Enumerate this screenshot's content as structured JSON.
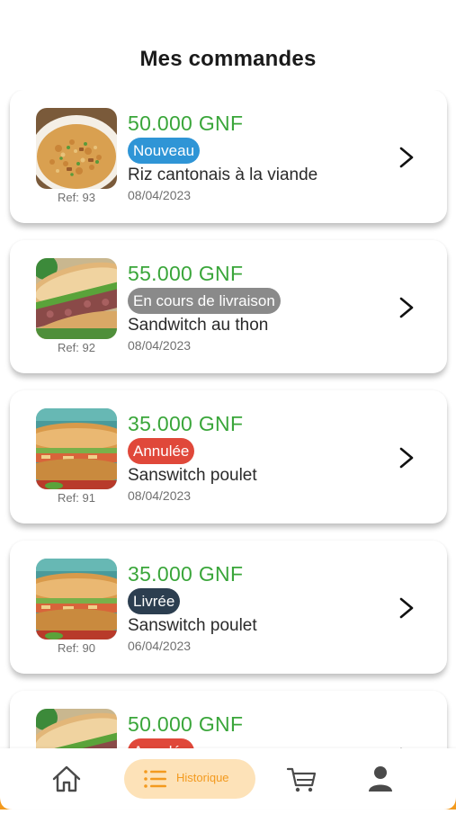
{
  "page": {
    "title": "Mes commandes"
  },
  "colors": {
    "price": "#3aa63a",
    "nouveau": "#2f95d6",
    "en_cours": "#8a8a8a",
    "annulee": "#e0483a",
    "livree": "#2c3e50",
    "nav_accent": "#f39a1e",
    "nav_active_bg": "#fde2b8"
  },
  "orders": [
    {
      "price": "50.000 GNF",
      "status": "Nouveau",
      "status_color": "#2f95d6",
      "name": "Riz cantonais à la viande",
      "date": "08/04/2023",
      "ref": "Ref: 93",
      "image": "fried-rice-image"
    },
    {
      "price": "55.000 GNF",
      "status": "En cours de livraison",
      "status_color": "#8a8a8a",
      "name": "Sandwitch au thon",
      "date": "08/04/2023",
      "ref": "Ref: 92",
      "image": "tuna-sandwich-image"
    },
    {
      "price": "35.000 GNF",
      "status": "Annulée",
      "status_color": "#e0483a",
      "name": "Sanswitch poulet",
      "date": "08/04/2023",
      "ref": "Ref: 91",
      "image": "chicken-sandwich-image"
    },
    {
      "price": "35.000 GNF",
      "status": "Livrée",
      "status_color": "#2c3e50",
      "name": "Sanswitch poulet",
      "date": "06/04/2023",
      "ref": "Ref: 90",
      "image": "chicken-sandwich-image"
    },
    {
      "price": "50.000 GNF",
      "status": "Annulée",
      "status_color": "#e0483a",
      "name": "",
      "date": "",
      "ref": "",
      "image": "tuna-sandwich-image"
    }
  ],
  "nav": {
    "items": [
      {
        "icon": "home-icon"
      },
      {
        "icon": "list-icon",
        "label": "Historique",
        "active": true
      },
      {
        "icon": "cart-icon"
      },
      {
        "icon": "user-icon"
      }
    ]
  }
}
